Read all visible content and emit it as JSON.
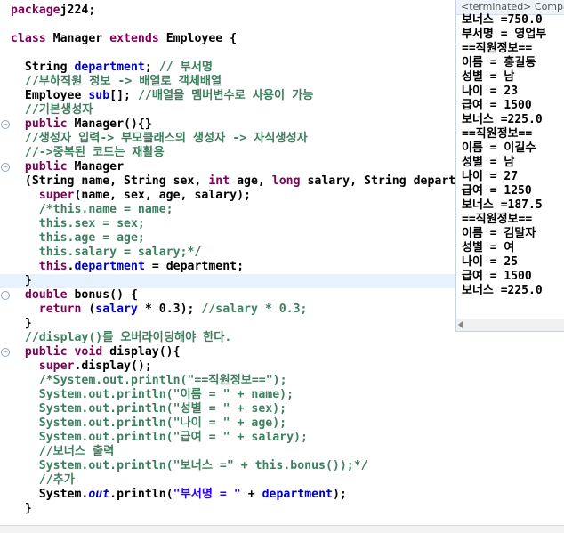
{
  "console": {
    "tab_label": "<terminated> Compa",
    "lines": [
      "보너스 =750.0",
      "부서명 = 영업부",
      "==직원정보==",
      "이름 = 홍길동",
      "성별 = 남",
      "나이 = 23",
      "급여 = 1500",
      "보너스 =225.0",
      "==직원정보==",
      "이름 = 이길수",
      "성별 = 남",
      "나이 = 27",
      "급여 = 1250",
      "보너스 =187.5",
      "==직원정보==",
      "이름 = 김말자",
      "성별 = 여",
      "나이 = 25",
      "급여 = 1500",
      "보너스 =225.0"
    ]
  },
  "code": {
    "l1": [
      [
        "kw",
        "package"
      ],
      [
        "",
        "j224;"
      ]
    ],
    "l2": [],
    "l3": [
      [
        "kw",
        "class"
      ],
      [
        "",
        " Manager "
      ],
      [
        "kw",
        "extends"
      ],
      [
        "",
        " Employee {"
      ]
    ],
    "l4": [],
    "l5": [
      [
        "",
        "  String "
      ],
      [
        "fd",
        "department"
      ],
      [
        "",
        "; "
      ],
      [
        "cm",
        "// 부서명"
      ]
    ],
    "l6": [
      [
        "cm",
        "  //부하직원 정보 -> 배열로 객체배열"
      ]
    ],
    "l7": [
      [
        "",
        "  Employee "
      ],
      [
        "fd",
        "sub"
      ],
      [
        "",
        "[]; "
      ],
      [
        "cm",
        "//배열을 멤버변수로 사용이 가능"
      ]
    ],
    "l8": [
      [
        "cm",
        "  //기본생성자"
      ]
    ],
    "l9": [
      [
        "kw",
        "  public"
      ],
      [
        "",
        " Manager(){}"
      ]
    ],
    "l10": [
      [
        "cm",
        "  //생성자 입력-> 부모클래스의 생성자 -> 자식생성자"
      ]
    ],
    "l11": [
      [
        "cm",
        "  //->중복된 코드는 재활용"
      ]
    ],
    "l12": [
      [
        "kw",
        "  public"
      ],
      [
        "",
        " Manager"
      ]
    ],
    "l13": [
      [
        "",
        "  (String name, String sex, "
      ],
      [
        "kw",
        "int"
      ],
      [
        "",
        " age, "
      ],
      [
        "kw",
        "long"
      ],
      [
        "",
        " salary, String department){"
      ]
    ],
    "l14": [
      [
        "kw",
        "    super"
      ],
      [
        "",
        "(name, sex, age, salary);"
      ]
    ],
    "l15": [
      [
        "cm",
        "    /*this.name = name;"
      ]
    ],
    "l16": [
      [
        "cm",
        "    this.sex = sex;"
      ]
    ],
    "l17": [
      [
        "cm",
        "    this.age = age;"
      ]
    ],
    "l18": [
      [
        "cm",
        "    this.salary = salary;*/"
      ]
    ],
    "l19": [
      [
        "kw",
        "    this"
      ],
      [
        "",
        "."
      ],
      [
        "fd",
        "department"
      ],
      [
        "",
        " = department;"
      ]
    ],
    "l20": [
      [
        "",
        "  }"
      ]
    ],
    "l21": [
      [
        "kw",
        "  double"
      ],
      [
        "",
        " bonus() {"
      ]
    ],
    "l22": [
      [
        "kw",
        "    return"
      ],
      [
        "",
        " ("
      ],
      [
        "fd",
        "salary"
      ],
      [
        "",
        " * 0.3); "
      ],
      [
        "cm",
        "//salary * 0.3;"
      ]
    ],
    "l23": [
      [
        "",
        "  }"
      ]
    ],
    "l24": [
      [
        "cm",
        "  //display()를 오버라이딩해야 한다."
      ]
    ],
    "l25": [
      [
        "kw",
        "  public void"
      ],
      [
        "",
        " display(){"
      ]
    ],
    "l26": [
      [
        "kw",
        "    super"
      ],
      [
        "",
        ".display();"
      ]
    ],
    "l27": [
      [
        "cm",
        "    /*System.out.println(\"==직원정보==\");"
      ]
    ],
    "l28": [
      [
        "cm",
        "    System.out.println(\"이름 = \" + name);"
      ]
    ],
    "l29": [
      [
        "cm",
        "    System.out.println(\"성별 = \" + sex);"
      ]
    ],
    "l30": [
      [
        "cm",
        "    System.out.println(\"나이 = \" + age);"
      ]
    ],
    "l31": [
      [
        "cm",
        "    System.out.println(\"급여 = \" + salary);"
      ]
    ],
    "l32": [
      [
        "cm",
        "    //보너스 출력"
      ]
    ],
    "l33": [
      [
        "cm",
        "    System.out.println(\"보너스 =\" + this.bonus());*/"
      ]
    ],
    "l34": [
      [
        "cm",
        "    //추가"
      ]
    ],
    "l35": [
      [
        "",
        "    System."
      ],
      [
        "fd it",
        "out"
      ],
      [
        "",
        ".println("
      ],
      [
        "st",
        "\"부서명 = \""
      ],
      [
        "",
        " + "
      ],
      [
        "fd",
        "department"
      ],
      [
        "",
        ");"
      ]
    ],
    "l36": [
      [
        "",
        "  }"
      ]
    ]
  }
}
